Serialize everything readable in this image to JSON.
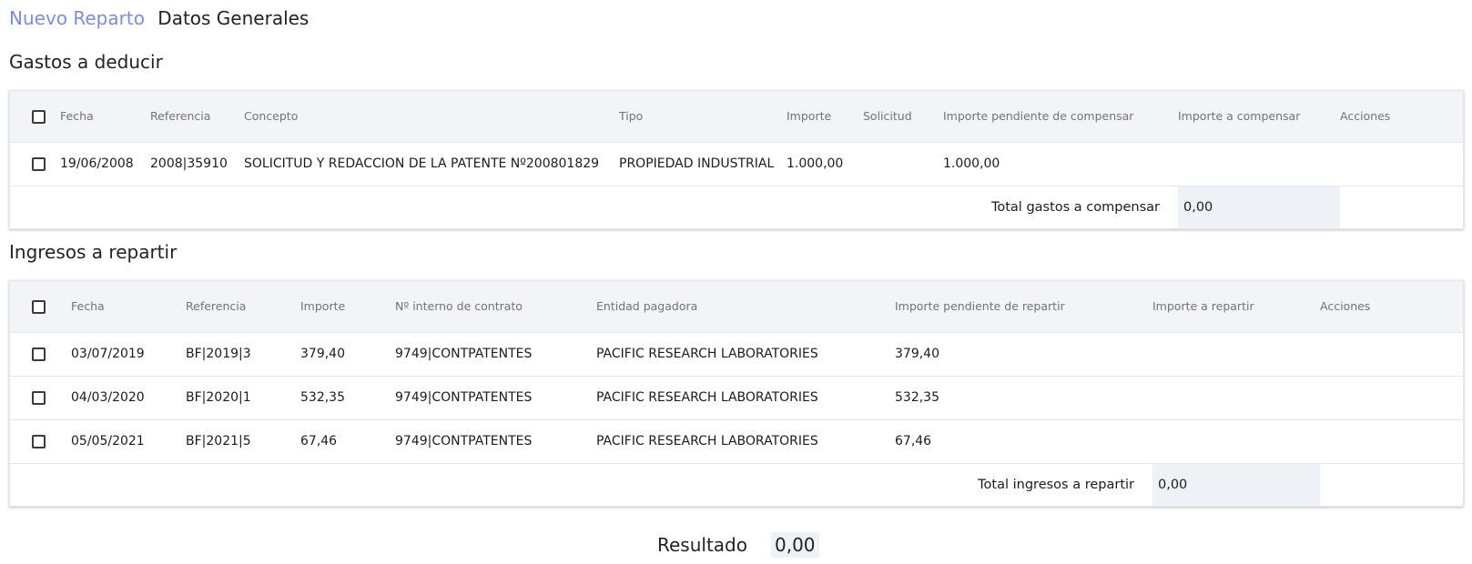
{
  "breadcrumb": {
    "link": "Nuevo Reparto",
    "current": "Datos Generales"
  },
  "gastos": {
    "title": "Gastos a deducir",
    "headers": [
      "Fecha",
      "Referencia",
      "Concepto",
      "Tipo",
      "Importe",
      "Solicitud",
      "Importe pendiente de compensar",
      "Importe a compensar",
      "Acciones"
    ],
    "rows": [
      {
        "fecha": "19/06/2008",
        "referencia": "2008|35910",
        "concepto": "SOLICITUD Y REDACCION DE LA PATENTE Nº200801829",
        "tipo": "PROPIEDAD INDUSTRIAL",
        "importe": "1.000,00",
        "solicitud": "",
        "pendiente": "1.000,00",
        "compensar": ""
      }
    ],
    "total_label": "Total gastos a compensar",
    "total_value": "0,00"
  },
  "ingresos": {
    "title": "Ingresos a repartir",
    "headers": [
      "Fecha",
      "Referencia",
      "Importe",
      "Nº interno de contrato",
      "Entidad pagadora",
      "Importe pendiente de repartir",
      "Importe a repartir",
      "Acciones"
    ],
    "rows": [
      {
        "fecha": "03/07/2019",
        "referencia": "BF|2019|3",
        "importe": "379,40",
        "contrato": "9749|CONTPATENTES",
        "entidad": "PACIFIC RESEARCH LABORATORIES",
        "pendiente": "379,40",
        "repartir": ""
      },
      {
        "fecha": "04/03/2020",
        "referencia": "BF|2020|1",
        "importe": "532,35",
        "contrato": "9749|CONTPATENTES",
        "entidad": "PACIFIC RESEARCH LABORATORIES",
        "pendiente": "532,35",
        "repartir": ""
      },
      {
        "fecha": "05/05/2021",
        "referencia": "BF|2021|5",
        "importe": "67,46",
        "contrato": "9749|CONTPATENTES",
        "entidad": "PACIFIC RESEARCH LABORATORIES",
        "pendiente": "67,46",
        "repartir": ""
      }
    ],
    "total_label": "Total ingresos a repartir",
    "total_value": "0,00"
  },
  "resultado": {
    "label": "Resultado",
    "value": "0,00"
  },
  "colors": {
    "accent": "#7a8fd6",
    "header_bg": "#f2f4f7",
    "total_bg": "#eef1f5"
  }
}
